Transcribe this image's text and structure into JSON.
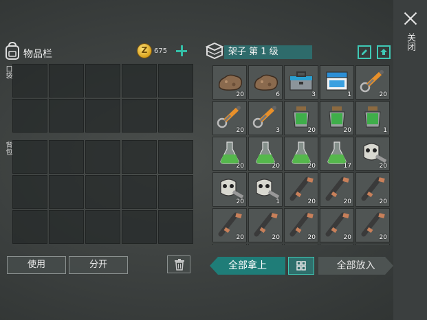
{
  "header": {
    "inventory_title": "物品栏",
    "coins": "675",
    "shelf_title": "架子 第 1 级",
    "close_label": "关闭"
  },
  "inventory": {
    "pocket_label": "口袋",
    "backpack_label": "背包"
  },
  "buttons": {
    "use": "使用",
    "split": "分开",
    "take_all": "全部拿上",
    "put_all": "全部放入"
  },
  "colors": {
    "accent": "#3fc9b6",
    "take_all_bg": "#1f7d78",
    "shelf_title_bg": "#2e6b6b"
  },
  "shelf": {
    "items": [
      {
        "icon": "stone-icon",
        "qty": "20"
      },
      {
        "icon": "stone-icon",
        "qty": "6"
      },
      {
        "icon": "toolbox-icon",
        "qty": "3"
      },
      {
        "icon": "cooler-box-icon",
        "qty": "1"
      },
      {
        "icon": "shock-absorber-icon",
        "qty": "20"
      },
      {
        "icon": "shock-absorber-icon",
        "qty": "20"
      },
      {
        "icon": "shock-absorber-icon",
        "qty": "3"
      },
      {
        "icon": "green-canister-icon",
        "qty": "20"
      },
      {
        "icon": "green-canister-icon",
        "qty": "20"
      },
      {
        "icon": "green-canister-icon",
        "qty": "1"
      },
      {
        "icon": "green-flask-icon",
        "qty": "20"
      },
      {
        "icon": "green-flask-icon",
        "qty": "20"
      },
      {
        "icon": "green-flask-icon",
        "qty": "20"
      },
      {
        "icon": "green-flask-icon",
        "qty": "17"
      },
      {
        "icon": "gas-mask-icon",
        "qty": "20"
      },
      {
        "icon": "gas-mask-icon",
        "qty": "20"
      },
      {
        "icon": "gas-mask-icon",
        "qty": "1"
      },
      {
        "icon": "pipe-icon",
        "qty": "20"
      },
      {
        "icon": "pipe-icon",
        "qty": "20"
      },
      {
        "icon": "pipe-icon",
        "qty": "20"
      },
      {
        "icon": "pipe-icon",
        "qty": "20"
      },
      {
        "icon": "pipe-icon",
        "qty": "20"
      },
      {
        "icon": "pipe-icon",
        "qty": "20"
      },
      {
        "icon": "pipe-icon",
        "qty": "20"
      },
      {
        "icon": "pipe-icon",
        "qty": "20"
      },
      {
        "icon": "empty",
        "qty": ""
      },
      {
        "icon": "empty",
        "qty": ""
      },
      {
        "icon": "empty",
        "qty": ""
      },
      {
        "icon": "empty",
        "qty": ""
      },
      {
        "icon": "empty",
        "qty": ""
      }
    ]
  }
}
